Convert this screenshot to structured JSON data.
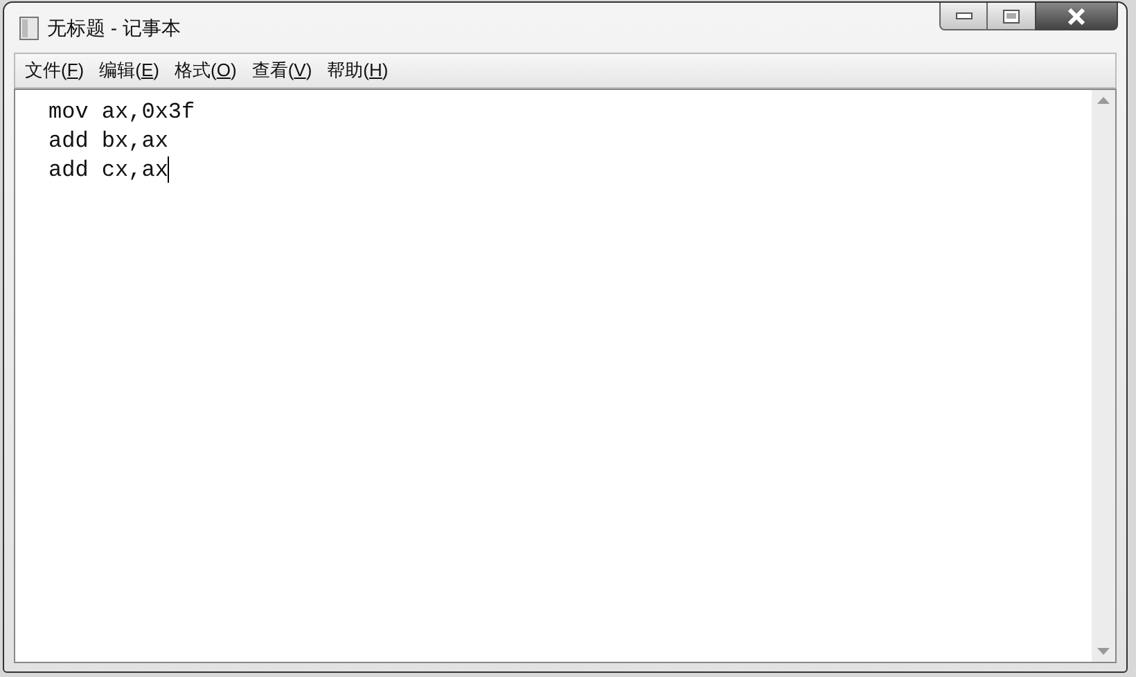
{
  "window": {
    "title": "无标题 - 记事本"
  },
  "menu": [
    {
      "prefix": "文件(",
      "key": "F",
      "suffix": ")"
    },
    {
      "prefix": "编辑(",
      "key": "E",
      "suffix": ")"
    },
    {
      "prefix": "格式(",
      "key": "O",
      "suffix": ")"
    },
    {
      "prefix": "查看(",
      "key": "V",
      "suffix": ")"
    },
    {
      "prefix": "帮助(",
      "key": "H",
      "suffix": ")"
    }
  ],
  "editor": {
    "lines": [
      "mov ax,0x3f",
      "add bx,ax",
      "add cx,ax"
    ]
  }
}
